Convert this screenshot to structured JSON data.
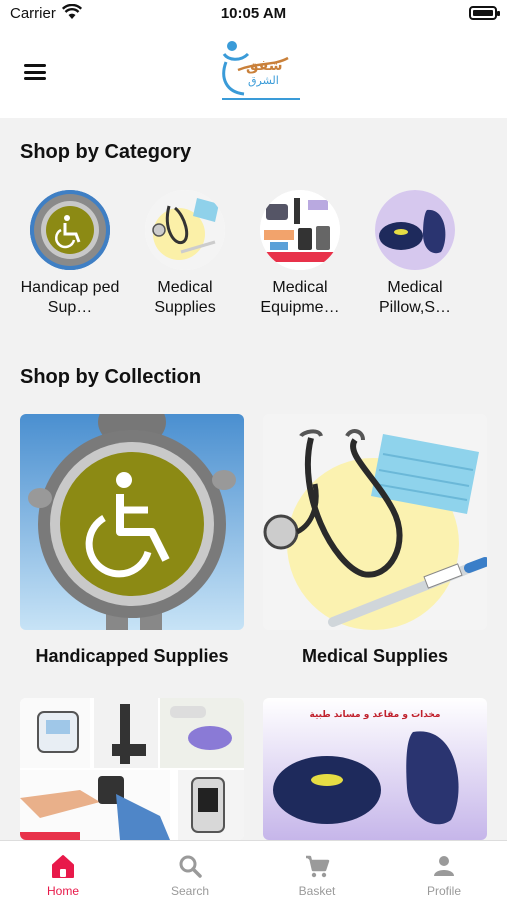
{
  "status_bar": {
    "carrier": "Carrier",
    "time": "10:05 AM"
  },
  "header": {
    "logo_text_primary": "شفق",
    "logo_text_secondary": "الشرق"
  },
  "sections": {
    "category_title": "Shop by Category",
    "collection_title": "Shop by Collection"
  },
  "categories": [
    {
      "label": "Handicap ped Sup…",
      "icon": "wheelchair-sign"
    },
    {
      "label": "Medical Supplies",
      "icon": "stethoscope"
    },
    {
      "label": "Medical Equipme…",
      "icon": "medical-devices-collage"
    },
    {
      "label": "Medical Pillow,S…",
      "icon": "cushions"
    }
  ],
  "collections": [
    {
      "label": "Handicapped Supplies",
      "icon": "wheelchair-sign"
    },
    {
      "label": "Medical Supplies",
      "icon": "stethoscope"
    },
    {
      "label": "",
      "icon": "medical-devices-collage"
    },
    {
      "label": "",
      "icon": "cushions",
      "banner_text": "مخدات و مقاعد و مساند طبية"
    }
  ],
  "tabbar": [
    {
      "label": "Home",
      "icon": "home-icon",
      "active": true
    },
    {
      "label": "Search",
      "icon": "search-icon",
      "active": false
    },
    {
      "label": "Basket",
      "icon": "cart-icon",
      "active": false
    },
    {
      "label": "Profile",
      "icon": "person-icon",
      "active": false
    }
  ],
  "colors": {
    "accent": "#e8194a",
    "inactive": "#9a9a9a",
    "background": "#f2f2f2"
  }
}
